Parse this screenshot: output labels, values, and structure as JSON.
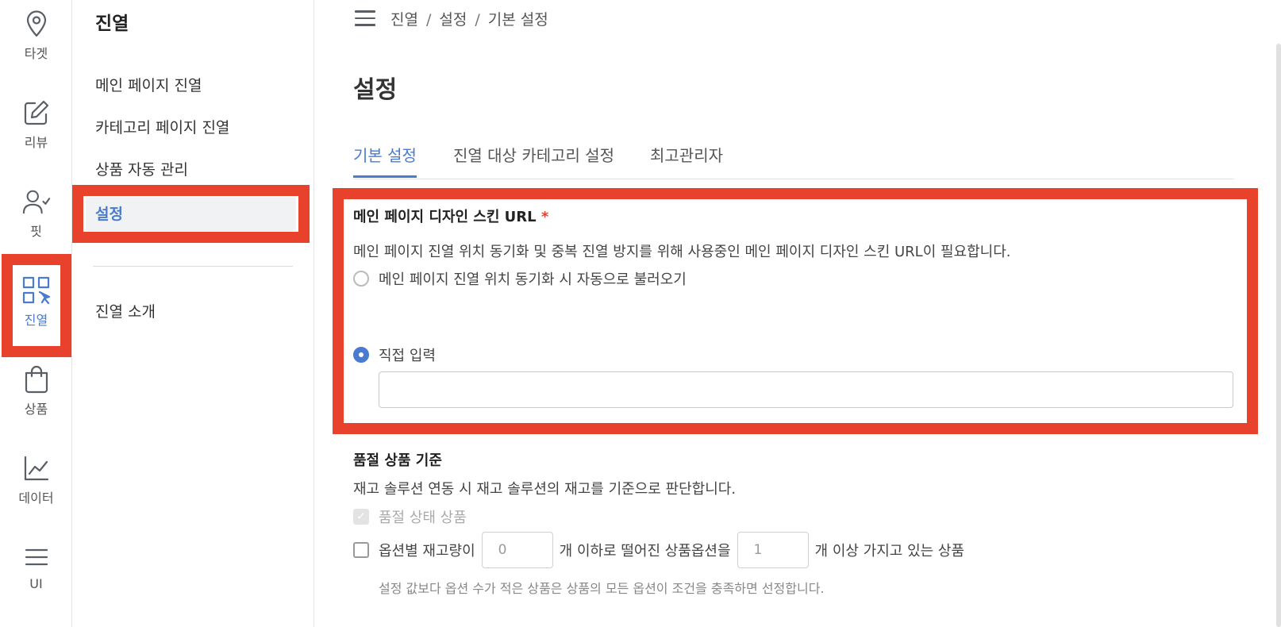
{
  "rail": {
    "items": [
      {
        "label": "타겟",
        "icon": "map-pin-icon"
      },
      {
        "label": "리뷰",
        "icon": "edit-icon"
      },
      {
        "label": "핏",
        "icon": "user-check-icon"
      },
      {
        "label": "진열",
        "icon": "grid-cursor-icon",
        "active": true
      },
      {
        "label": "상품",
        "icon": "shopping-bag-icon"
      },
      {
        "label": "데이터",
        "icon": "line-chart-icon"
      },
      {
        "label": "UI",
        "icon": "menu-icon"
      }
    ]
  },
  "subnav": {
    "title": "진열",
    "items": [
      "메인 페이지 진열",
      "카테고리 페이지 진열",
      "상품 자동 관리"
    ],
    "active": "설정",
    "extra": "진열 소개"
  },
  "header": {
    "breadcrumb": [
      "진열",
      "설정",
      "기본 설정"
    ]
  },
  "page": {
    "title": "설정",
    "tabs": [
      "기본 설정",
      "진열 대상 카테고리 설정",
      "최고관리자"
    ]
  },
  "skin_url": {
    "label": "메인 페이지 디자인 스킨 URL",
    "required_mark": "*",
    "description": "메인 페이지 진열 위치 동기화 및 중복 진열 방지를 위해 사용중인 메인 페이지 디자인 스킨 URL이 필요합니다.",
    "option_auto": "메인 페이지 진열 위치 동기화 시 자동으로 불러오기",
    "option_manual": "직접 입력",
    "input_value": ""
  },
  "soldout": {
    "label": "품절 상품 기준",
    "description": "재고 솔루션 연동 시 재고 솔루션의 재고를 기준으로 판단합니다.",
    "option_soldout": "품절 상태 상품",
    "option_stock_prefix": "옵션별 재고량이",
    "stock_value": "0",
    "option_stock_middle": "개 이하로 떨어진 상품옵션을",
    "count_value": "1",
    "option_stock_suffix": "개 이상 가지고 있는 상품",
    "hint": "설정 값보다 옵션 수가 적은 상품은 상품의 모든 옵션이 조건을 충족하면 선정합니다."
  },
  "colors": {
    "accent": "#4a7bd0",
    "highlight": "#e8412c"
  }
}
